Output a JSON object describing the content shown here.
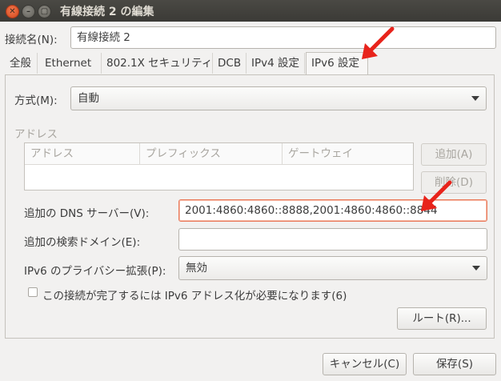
{
  "window": {
    "title": "有線接続 2 の編集",
    "close_glyph": "✕",
    "min_glyph": "–",
    "max_glyph": "▢"
  },
  "connection_name": {
    "label": "接続名(N):",
    "value": "有線接続 2"
  },
  "tabs": [
    {
      "label": "全般"
    },
    {
      "label": "Ethernet"
    },
    {
      "label": "802.1X セキュリティ"
    },
    {
      "label": "DCB"
    },
    {
      "label": "IPv4 設定"
    },
    {
      "label": "IPv6 設定",
      "active": true
    }
  ],
  "method": {
    "label": "方式(M):",
    "value": "自動"
  },
  "addresses": {
    "section_label": "アドレス",
    "columns": [
      "アドレス",
      "プレフィックス",
      "ゲートウェイ"
    ],
    "add_button": "追加(A)",
    "delete_button": "削除(D)"
  },
  "dns": {
    "label": "追加の DNS サーバー(V):",
    "value": "2001:4860:4860::8888,2001:4860:4860::8844"
  },
  "search_domains": {
    "label": "追加の検索ドメイン(E):",
    "value": ""
  },
  "privacy": {
    "label": "IPv6 のプライバシー拡張(P):",
    "value": "無効"
  },
  "require_ipv6": {
    "label": "この接続が完了するには IPv6 アドレス化が必要になります(6)",
    "checked": false
  },
  "routes_button": "ルート(R)...",
  "footer": {
    "cancel": "キャンセル(C)",
    "save": "保存(S)"
  },
  "colors": {
    "accent": "#e9795a",
    "annotation_arrow": "#e8231b"
  }
}
